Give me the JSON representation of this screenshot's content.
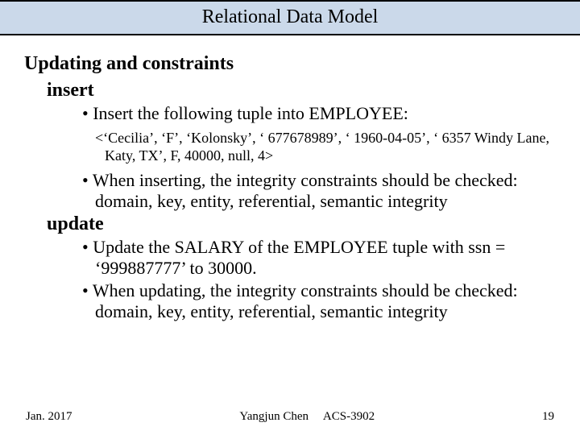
{
  "title": "Relational Data Model",
  "heading": "Updating and constraints",
  "sections": [
    {
      "label": "insert",
      "bullets": [
        "Insert the following tuple into EMPLOYEE:",
        "When inserting, the integrity constraints should be checked: domain, key, entity, referential, semantic integrity"
      ],
      "tuple": "<‘Cecilia’, ‘F’, ‘Kolonsky’, ‘ 677678989’, ‘ 1960-04-05’, ‘ 6357 Windy Lane, Katy, TX’, F, 40000, null, 4>"
    },
    {
      "label": "update",
      "bullets": [
        "Update the SALARY of the EMPLOYEE tuple with ssn = ‘999887777’ to 30000.",
        "When updating, the integrity constraints should be checked: domain, key, entity, referential, semantic integrity"
      ]
    }
  ],
  "footer": {
    "date": "Jan. 2017",
    "center": "Yangjun Chen  ACS-3902",
    "page": "19"
  }
}
